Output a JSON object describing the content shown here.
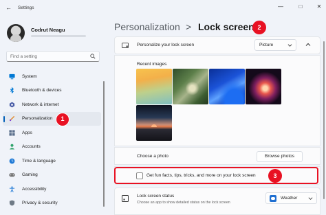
{
  "window": {
    "title": "Settings",
    "controls": [
      "minimize",
      "maximize",
      "close"
    ]
  },
  "user": {
    "name": "Codrut Neagu"
  },
  "search": {
    "placeholder": "Find a setting"
  },
  "sidebar": {
    "items": [
      {
        "label": "System",
        "icon": "monitor-icon",
        "color": "#0078d4"
      },
      {
        "label": "Bluetooth & devices",
        "icon": "bluetooth-icon",
        "color": "#0078d4"
      },
      {
        "label": "Network & internet",
        "icon": "network-icon",
        "color": "#4a5ea8"
      },
      {
        "label": "Personalization",
        "icon": "brush-icon",
        "color": "#e08a2e",
        "active": true,
        "badge": "1"
      },
      {
        "label": "Apps",
        "icon": "apps-icon",
        "color": "#5a6f8c"
      },
      {
        "label": "Accounts",
        "icon": "person-icon",
        "color": "#2fa36b"
      },
      {
        "label": "Time & language",
        "icon": "globe-clock-icon",
        "color": "#1f7ad6"
      },
      {
        "label": "Gaming",
        "icon": "gamepad-icon",
        "color": "#6f6f6f"
      },
      {
        "label": "Accessibility",
        "icon": "accessibility-icon",
        "color": "#1f7ad6"
      },
      {
        "label": "Privacy & security",
        "icon": "shield-icon",
        "color": "#6f7a86"
      }
    ]
  },
  "breadcrumb": {
    "parent": "Personalization",
    "separator": ">",
    "current": "Lock screen",
    "badge": "2"
  },
  "personalize": {
    "label": "Personalize your lock screen",
    "dropdown_value": "Picture"
  },
  "recent": {
    "label": "Recent images",
    "images": [
      "yellow-gradient",
      "forest-waterfall",
      "blue-bloom",
      "red-glow",
      "sunset-shore"
    ]
  },
  "choose": {
    "label": "Choose a photo",
    "button": "Browse photos"
  },
  "funfacts": {
    "label": "Get fun facts, tips, tricks, and more on your lock screen",
    "checked": false,
    "badge": "3"
  },
  "status": {
    "title": "Lock screen status",
    "subtitle": "Choose an app to show detailed status on the lock screen",
    "dropdown_value": "Weather"
  },
  "colors": {
    "accent": "#005fb8",
    "badge": "#e81123",
    "background": "#f0f3f9"
  }
}
